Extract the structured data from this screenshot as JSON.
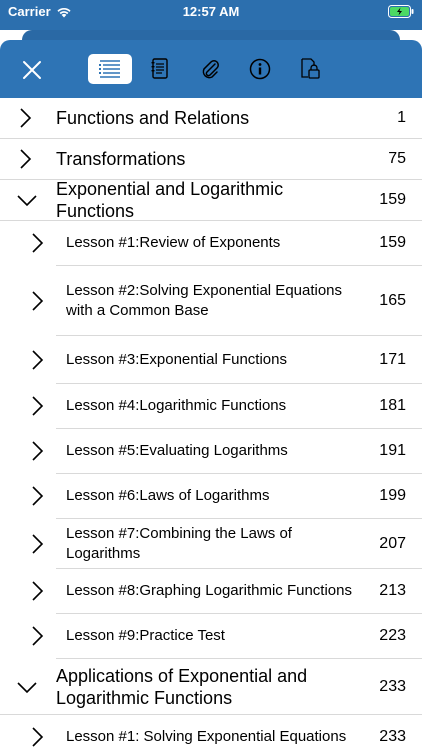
{
  "status": {
    "carrier": "Carrier",
    "time": "12:57 AM"
  },
  "colors": {
    "toolbar": "#2e74b5",
    "status_bar": "#2c6fae",
    "divider": "#d9d9d9"
  },
  "toolbar": {
    "icons": [
      "close-icon",
      "toc-list-icon",
      "notes-icon",
      "attachment-icon",
      "info-icon",
      "lock-document-icon"
    ],
    "active": "toc-list-icon"
  },
  "toc": [
    {
      "level": 1,
      "title": "Functions and Relations",
      "page": "1",
      "expanded": false
    },
    {
      "level": 1,
      "title": "Transformations",
      "page": "75",
      "expanded": false
    },
    {
      "level": 1,
      "title": "Exponential and Logarithmic Functions",
      "page": "159",
      "expanded": true
    },
    {
      "level": 2,
      "title": "Lesson #1:Review of Exponents",
      "page": "159"
    },
    {
      "level": 2,
      "title": "Lesson #2:Solving Exponential Equations with a Common Base",
      "page": "165"
    },
    {
      "level": 2,
      "title": "Lesson #3:Exponential Functions",
      "page": "171"
    },
    {
      "level": 2,
      "title": "Lesson #4:Logarithmic Functions",
      "page": "181"
    },
    {
      "level": 2,
      "title": "Lesson #5:Evaluating Logarithms",
      "page": "191"
    },
    {
      "level": 2,
      "title": "Lesson #6:Laws of Logarithms",
      "page": "199"
    },
    {
      "level": 2,
      "title": "Lesson #7:Combining the Laws of Logarithms",
      "page": "207"
    },
    {
      "level": 2,
      "title": "Lesson #8:Graphing Logarithmic Functions",
      "page": "213"
    },
    {
      "level": 2,
      "title": "Lesson #9:Practice Test",
      "page": "223"
    },
    {
      "level": 1,
      "title": "Applications of Exponential and Logarithmic Functions",
      "page": "233",
      "expanded": true
    },
    {
      "level": 2,
      "title": "Lesson #1: Solving Exponential Equations",
      "page": "233"
    }
  ]
}
